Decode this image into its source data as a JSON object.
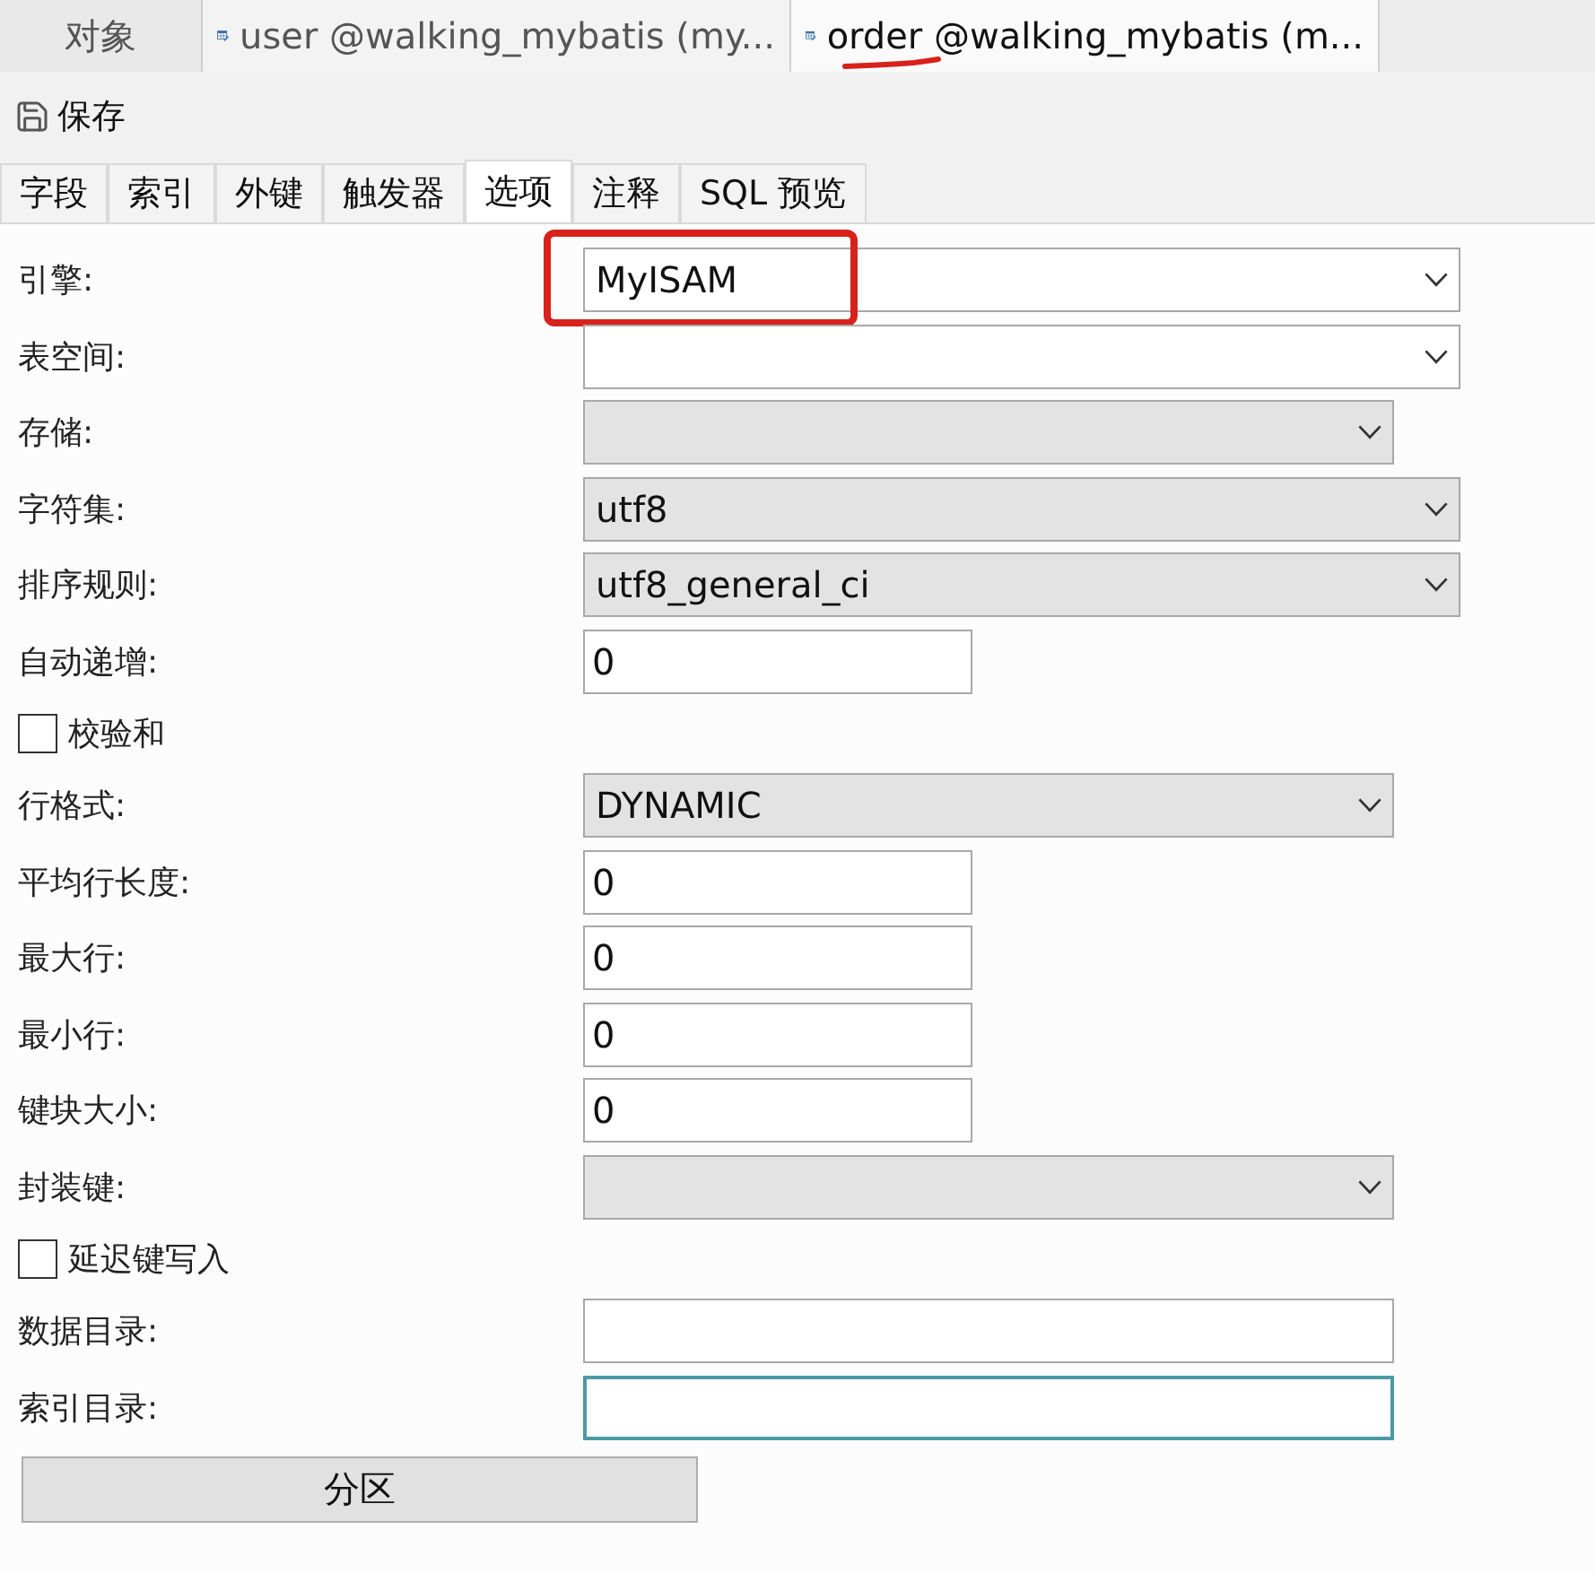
{
  "doc_tabs": [
    {
      "label": "对象",
      "kind": "plain",
      "selected": false,
      "highlighted": false
    },
    {
      "label": "user @walking_mybatis (my...",
      "kind": "table",
      "selected": false,
      "highlighted": false
    },
    {
      "label": "order",
      "suffix": " @walking_mybatis (m...",
      "kind": "table",
      "selected": true,
      "highlighted": true
    }
  ],
  "toolbar": {
    "save_label": "保存"
  },
  "tabs": [
    {
      "label": "字段",
      "selected": false
    },
    {
      "label": "索引",
      "selected": false
    },
    {
      "label": "外键",
      "selected": false
    },
    {
      "label": "触发器",
      "selected": false
    },
    {
      "label": "选项",
      "selected": true
    },
    {
      "label": "注释",
      "selected": false
    },
    {
      "label": "SQL 预览",
      "selected": false
    }
  ],
  "options": [
    {
      "kind": "combo",
      "label": "引擎:",
      "value": "MyISAM",
      "highlighted": true,
      "focused": false
    },
    {
      "kind": "combo",
      "label": "表空间:",
      "highlighted": false,
      "focused": false
    },
    {
      "kind": "select",
      "label": "存储:",
      "short": true,
      "highlighted": false,
      "focused": false
    },
    {
      "kind": "select",
      "label": "字符集:",
      "value": "utf8",
      "short": false,
      "highlighted": false,
      "focused": false
    },
    {
      "kind": "select",
      "label": "排序规则:",
      "value": "utf8_general_ci",
      "short": false,
      "highlighted": false,
      "focused": false
    },
    {
      "kind": "text",
      "label": "自动递增:",
      "value": "0",
      "highlighted": false,
      "focused": false
    },
    {
      "kind": "checkbox",
      "label": "校验和",
      "checked": false
    },
    {
      "kind": "select",
      "label": "行格式:",
      "value": "DYNAMIC",
      "short": true,
      "highlighted": false,
      "focused": false
    },
    {
      "kind": "text",
      "label": "平均行长度:",
      "value": "0",
      "highlighted": false,
      "focused": false
    },
    {
      "kind": "text",
      "label": "最大行:",
      "value": "0",
      "highlighted": false,
      "focused": false
    },
    {
      "kind": "text",
      "label": "最小行:",
      "value": "0",
      "highlighted": false,
      "focused": false
    },
    {
      "kind": "text",
      "label": "键块大小:",
      "value": "0",
      "highlighted": false,
      "focused": false
    },
    {
      "kind": "select",
      "label": "封装键:",
      "short": true,
      "highlighted": false,
      "focused": false
    },
    {
      "kind": "checkbox",
      "label": "延迟键写入",
      "checked": false
    },
    {
      "kind": "path",
      "label": "数据目录:",
      "highlighted": false,
      "focused": false
    },
    {
      "kind": "path",
      "label": "索引目录:",
      "highlighted": false,
      "focused": true
    }
  ],
  "partition_button": "分区"
}
